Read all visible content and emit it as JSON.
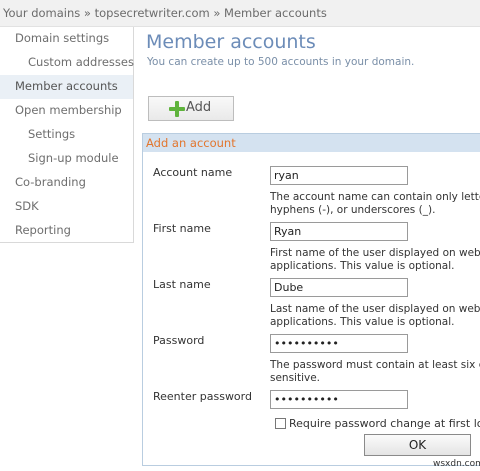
{
  "breadcrumb": {
    "text": "Your domains » topsecretwriter.com » Member accounts"
  },
  "sidebar": {
    "items": [
      {
        "label": "Domain settings"
      },
      {
        "label": "Custom addresses"
      },
      {
        "label": "Member accounts"
      },
      {
        "label": "Open membership"
      },
      {
        "label": "Settings"
      },
      {
        "label": "Sign-up module"
      },
      {
        "label": "Co-branding"
      },
      {
        "label": "SDK"
      },
      {
        "label": "Reporting"
      }
    ]
  },
  "main": {
    "title": "Member accounts",
    "subtitle": "You can create up to 500 accounts in your domain.",
    "add_label": "Add"
  },
  "form": {
    "header": "Add an account",
    "account_name_label": "Account name",
    "account_name_value": "ryan",
    "account_name_hint": "The account name can contain only letters,\nhyphens (-), or underscores (_).",
    "first_name_label": "First name",
    "first_name_value": "Ryan",
    "first_name_hint": "First name of the user displayed on web pa\napplications. This value is optional.",
    "last_name_label": "Last name",
    "last_name_value": "Dube",
    "last_name_hint": "Last name of the user displayed on web pa\napplications. This value is optional.",
    "password_label": "Password",
    "password_value": "••••••••••",
    "password_hint": "The password must contain at least six char\nsensitive.",
    "reenter_label": "Reenter password",
    "reenter_value": "••••••••••",
    "require_change_label": "Require password change at first login",
    "ok_label": "OK"
  },
  "watermark": "wsxdn.com"
}
